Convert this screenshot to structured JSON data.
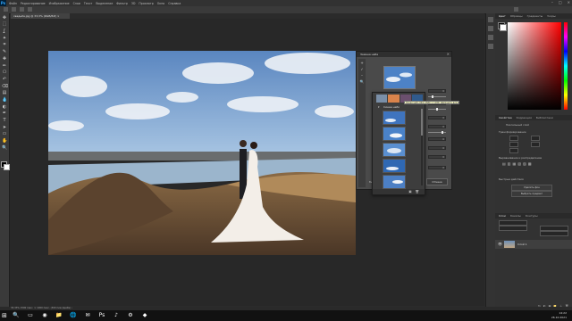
{
  "app": {
    "logo": "Ps",
    "menu": [
      "Файл",
      "Редактирование",
      "Изображение",
      "Слои",
      "Текст",
      "Выделение",
      "Фильтр",
      "3D",
      "Просмотр",
      "Окно",
      "Справка"
    ],
    "window_controls": [
      "–",
      "□",
      "×"
    ],
    "title_center": "Adobe Photoshop 2021"
  },
  "document_tab": {
    "label": "свадьба.jpg @ 33,3% (RGB/8#) ×"
  },
  "toolbar": {
    "tools": [
      "move-icon",
      "marquee-icon",
      "lasso-icon",
      "magic-wand-icon",
      "crop-icon",
      "eyedropper-icon",
      "healing-icon",
      "brush-icon",
      "stamp-icon",
      "history-brush-icon",
      "eraser-icon",
      "gradient-icon",
      "blur-icon",
      "dodge-icon",
      "pen-icon",
      "type-icon",
      "path-select-icon",
      "shape-icon",
      "hand-icon",
      "zoom-icon"
    ],
    "tool_glyphs": [
      "✥",
      "⬚",
      "ʆ",
      "✦",
      "⌗",
      "✎",
      "✚",
      "✏",
      "⎔",
      "↶",
      "⌫",
      "▤",
      "💧",
      "◐",
      "✒",
      "T",
      "➤",
      "▭",
      "✋",
      "🔍"
    ]
  },
  "neural_filter": {
    "title": "Замена неба",
    "close": "×",
    "side_tools": [
      "+",
      "✓",
      "–",
      "🔍"
    ],
    "controls": [
      "0",
      "0",
      "0",
      "0",
      "0",
      "0",
      "0",
      "0"
    ],
    "sliders": [
      0.2,
      0.5,
      0.85
    ],
    "ok_label": "Отмена",
    "output_label": "Вывод"
  },
  "presets": {
    "label": "Синее небо",
    "arrow": "▾",
    "strip_colors": [
      "#7a8fa8",
      "#d9834b",
      "#6b4f6e",
      "#305a8c"
    ],
    "footer_icons": [
      "▣",
      "🗑"
    ],
    "skies": 5
  },
  "tooltip": {
    "text": "Синее небо 004 (1580 × 1100) Щелкните для выбора"
  },
  "right_panel": {
    "color_tabs": [
      "Цвет",
      "Образцы",
      "Градиенты",
      "Узоры"
    ],
    "props_tabs": [
      "Свойства",
      "Коррекция",
      "Библиотеки"
    ],
    "props_title": "Пиксельный слой",
    "transform_label": "Трансформирование",
    "align_label": "Выравнивание и распределение",
    "quick_label": "Быстрые действия",
    "quick_buttons": [
      "Удалить фон",
      "Выбрать предмет"
    ],
    "layers_tabs": [
      "Слои",
      "Каналы",
      "Контуры"
    ],
    "layer_name": "Слой 1",
    "layer_icons": [
      "fx",
      "◐",
      "▣",
      "📁",
      "＋",
      "🗑"
    ]
  },
  "status": {
    "text": "33,33%   1500 пикс. × 1000 пикс. (300 пикс/дюйм)   ›"
  },
  "taskbar": {
    "start": "⊞",
    "search": "🔍",
    "apps": [
      "▭",
      "◉",
      "📁",
      "🌐",
      "✉",
      "Ps",
      "♪",
      "⚙",
      "◆"
    ],
    "time": "14:22",
    "date": "26.10.2021"
  }
}
